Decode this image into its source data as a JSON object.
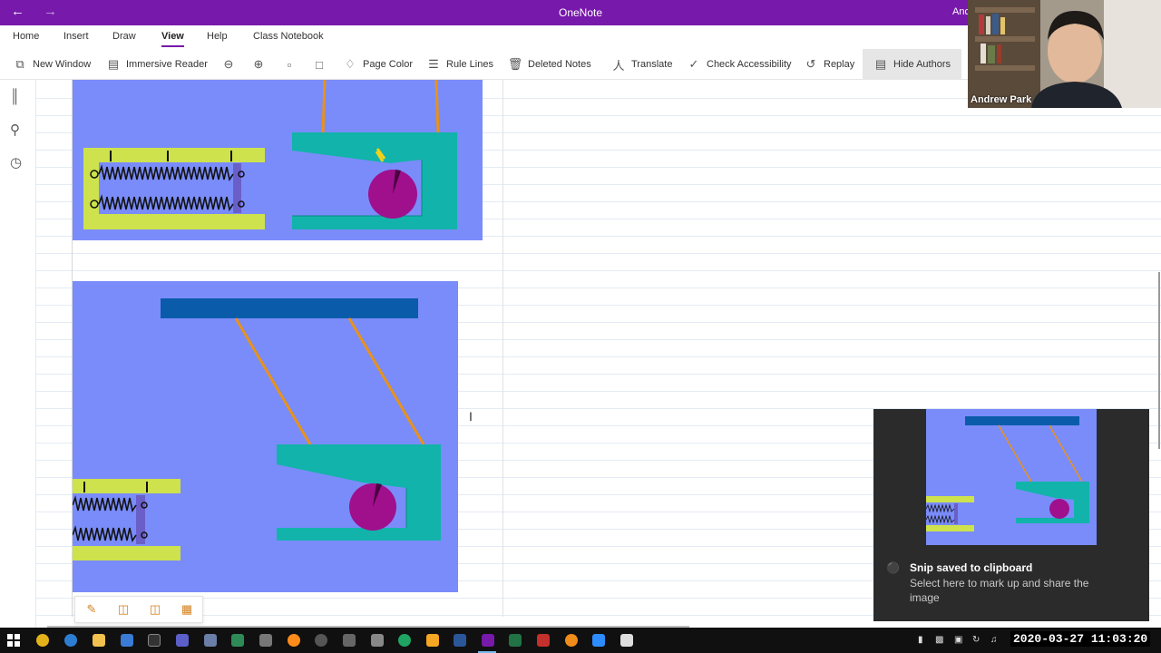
{
  "titlebar": {
    "title": "OneNote",
    "user_fragment": "Anc",
    "back_icon": "arrow-left-icon",
    "forward_icon": "arrow-right-icon"
  },
  "menu": {
    "tabs": [
      "Home",
      "Insert",
      "Draw",
      "View",
      "Help",
      "Class Notebook"
    ],
    "active_tab": "View"
  },
  "toolbar": {
    "new_window": "New Window",
    "immersive_reader": "Immersive Reader",
    "page_color": "Page Color",
    "rule_lines": "Rule Lines",
    "deleted_notes": "Deleted Notes",
    "translate": "Translate",
    "check_accessibility": "Check Accessibility",
    "replay": "Replay",
    "hide_authors": "Hide Authors"
  },
  "webcam": {
    "name": "Andrew Park"
  },
  "toast": {
    "title": "Snip saved to clipboard",
    "message": "Select here to mark up and share the image"
  },
  "clock": "2020-03-27 11:03:20",
  "colors": {
    "accent_purple": "#7719aa",
    "diagram_background": "#7a8cfa",
    "bar_blue": "#0a5caa",
    "rope_orange": "#e8921a",
    "housing_teal": "#12b3aa",
    "plunger_lime": "#cde24c",
    "cam_magenta": "#a0108c"
  }
}
